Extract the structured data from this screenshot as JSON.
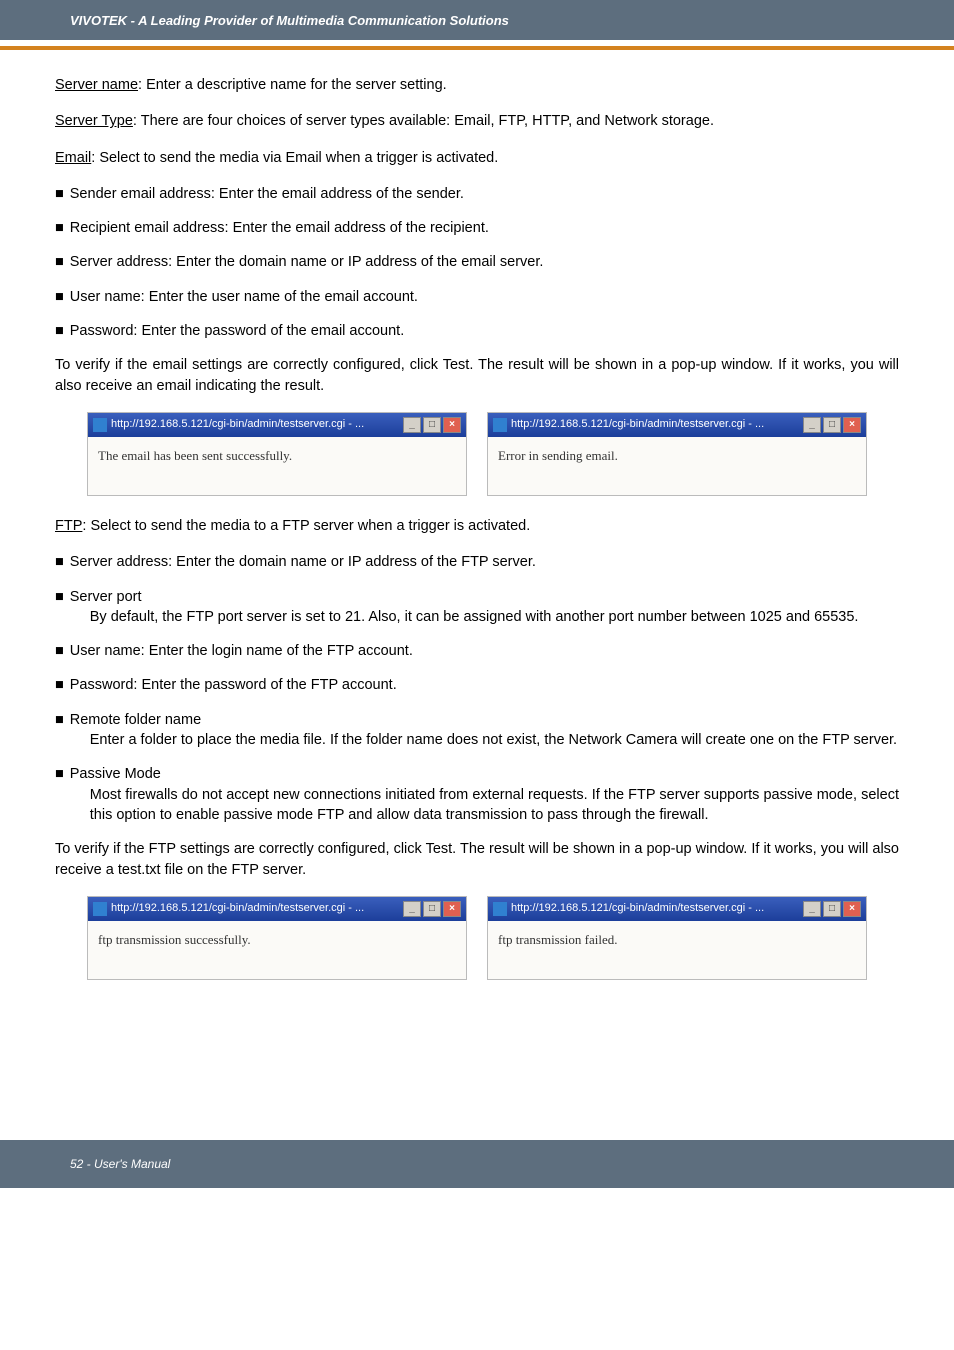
{
  "header": {
    "title": "VIVOTEK - A Leading Provider of Multimedia Communication Solutions"
  },
  "body": {
    "server_name_label": "Server name",
    "server_name_text": ": Enter a descriptive name for the server setting.",
    "server_type_label": "Server Type",
    "server_type_text": ": There are four choices of server types available: Email, FTP, HTTP, and Network storage.",
    "email_label": "Email",
    "email_text": ": Select to send the media via Email when a trigger is activated.",
    "email_b1": "Sender email address: Enter the email address of the sender.",
    "email_b2": "Recipient email address: Enter the email address of the recipient.",
    "email_b3": "Server address: Enter the domain name or IP address of the email server.",
    "email_b4": "User name: Enter the user name of the email account.",
    "email_b5": "Password: Enter the password of the email account.",
    "email_verify": "To verify if the email settings are correctly configured, click Test. The result will be shown in a pop-up window. If it works, you will also receive an email indicating the result.",
    "popup_email_title": "http://192.168.5.121/cgi-bin/admin/testserver.cgi - ...",
    "popup_email_ok": "The email has been sent successfully.",
    "popup_email_fail": "Error in sending email.",
    "ftp_label": "FTP",
    "ftp_text": ": Select to send the media to a FTP server when a trigger is activated.",
    "ftp_b1": "Server address: Enter the domain name or IP address of the FTP server.",
    "ftp_b2_head": "Server port",
    "ftp_b2_body": "By default, the FTP port server is set to 21. Also, it can be assigned with another port  number between 1025 and 65535.",
    "ftp_b3": "User name: Enter the login name of the FTP account.",
    "ftp_b4": "Password: Enter the password of the FTP account.",
    "ftp_b5_head": "Remote folder name",
    "ftp_b5_body": "Enter a folder to place the media file. If the folder name does not exist, the Network Camera will create one on the FTP server.",
    "ftp_b6_head": "Passive Mode",
    "ftp_b6_body": "Most firewalls do not accept new connections initiated from external requests. If the FTP server supports passive mode, select this option to enable passive mode FTP and allow data transmission to pass through the firewall.",
    "ftp_verify": "To verify if the FTP settings are correctly configured, click Test. The result will be shown in a pop-up window. If it works, you will also receive a test.txt file on the FTP server.",
    "popup_ftp_title": "http://192.168.5.121/cgi-bin/admin/testserver.cgi - ...",
    "popup_ftp_ok": "ftp transmission successfully.",
    "popup_ftp_fail": "ftp transmission failed."
  },
  "footer": {
    "text": "52 - User's Manual"
  },
  "win": {
    "min": "_",
    "max": "□",
    "close": "×"
  }
}
